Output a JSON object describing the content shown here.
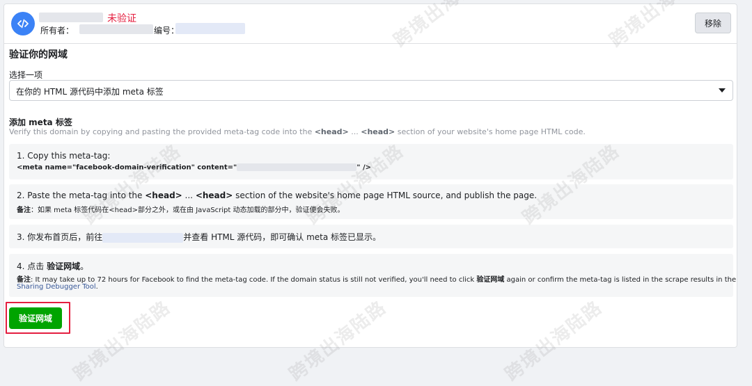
{
  "header": {
    "status": "未验证",
    "owner_label": "所有者：",
    "id_label": "编号：",
    "remove_label": "移除"
  },
  "section": {
    "title": "验证你的网域",
    "select_label": "选择一项",
    "select_value": "在你的 HTML 源代码中添加 meta 标签"
  },
  "add_meta": {
    "title": "添加 meta 标签",
    "desc_pre": "Verify this domain by copying and pasting the provided meta-tag code into the ",
    "desc_head1": "<head>",
    "desc_mid": " ... ",
    "desc_head2": "<head>",
    "desc_post": " section of your website's home page HTML code."
  },
  "steps": {
    "s1_title": "1. Copy this meta-tag:",
    "s1_code_pre": "<meta name=\"facebook-domain-verification\" content=\"",
    "s1_code_post": "\" />",
    "s2_pre": "2. Paste the meta-tag into the ",
    "s2_head1": "<head>",
    "s2_mid": " ... ",
    "s2_head2": "<head>",
    "s2_post": " section of the website's home page HTML source, and publish the page.",
    "s2_note_label": "备注",
    "s2_note": "：如果 meta 标签代码在<head>部分之外，或在由 JavaScript 动态加载的部分中，验证便会失败。",
    "s3_pre": "3. 你发布首页后，前往",
    "s3_post": "并查看 HTML 源代码，即可确认 meta 标签已显示。",
    "s4_pre": "4. 点击 ",
    "s4_bold": "验证网域",
    "s4_post": "。",
    "s4_note_label": "备注",
    "s4_note_pre": ": It may take up to 72 hours for Facebook to find the meta-tag code. If the domain status is still not verified, you'll need to click ",
    "s4_note_bold": "验证网域",
    "s4_note_post": " again or confirm the meta-tag is listed in the scrape results in the",
    "s4_link": "Sharing Debugger Tool",
    "s4_end": "."
  },
  "verify_button": "验证网域",
  "watermark": "跨境出海陆路",
  "colors": {
    "accent_blue": "#3b82f6",
    "verify_green": "#00a400",
    "status_red": "#e41e3f",
    "link_blue": "#385898"
  },
  "icons": {
    "domain": "code-icon",
    "dropdown": "caret-down-icon"
  }
}
